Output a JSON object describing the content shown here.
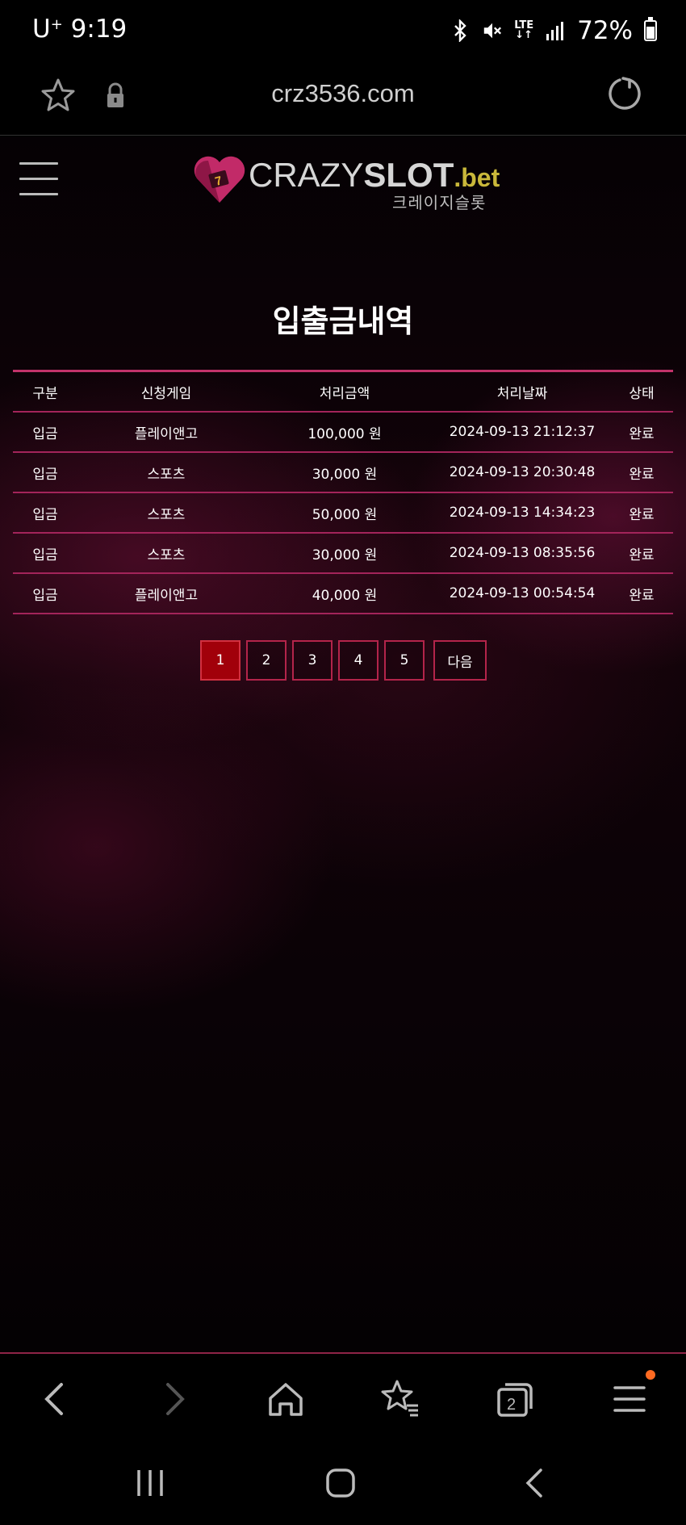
{
  "status_bar": {
    "carrier": "U",
    "carrier_sup": "+",
    "time": "9:19",
    "network": "LTE",
    "battery": "72%",
    "icons": [
      "bluetooth-icon",
      "mute-icon",
      "lte-icon",
      "signal-icon",
      "battery-icon"
    ]
  },
  "browser": {
    "url": "crz3536.com",
    "icons": [
      "bookmark-star-icon",
      "lock-icon",
      "reload-icon"
    ]
  },
  "site": {
    "logo_crazy": "CRAZY",
    "logo_slot": "SLOT",
    "logo_bet": ".bet",
    "logo_korean": "크레이지슬롯",
    "page_title": "입출금내역"
  },
  "table": {
    "headers": [
      "구분",
      "신청게임",
      "처리금액",
      "처리날짜",
      "상태"
    ],
    "rows": [
      [
        "입금",
        "플레이앤고",
        "100,000 원",
        "2024-09-13 21:12:37",
        "완료"
      ],
      [
        "입금",
        "스포츠",
        "30,000 원",
        "2024-09-13 20:30:48",
        "완료"
      ],
      [
        "입금",
        "스포츠",
        "50,000 원",
        "2024-09-13 14:34:23",
        "완료"
      ],
      [
        "입금",
        "스포츠",
        "30,000 원",
        "2024-09-13 08:35:56",
        "완료"
      ],
      [
        "입금",
        "플레이앤고",
        "40,000 원",
        "2024-09-13 00:54:54",
        "완료"
      ]
    ]
  },
  "pagination": {
    "pages": [
      "1",
      "2",
      "3",
      "4",
      "5"
    ],
    "current": "1",
    "next_label": "다음"
  },
  "toolbar": {
    "tabs_count": "2",
    "accent_color": "#a3245a",
    "notification_color": "#ff6a21"
  }
}
